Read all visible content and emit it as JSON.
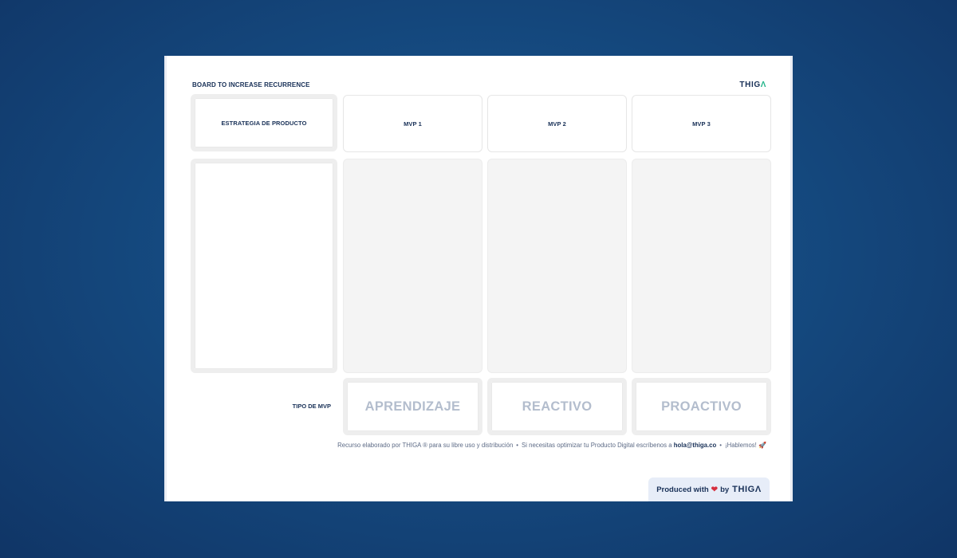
{
  "board": {
    "title": "BOARD TO INCREASE RECURRENCE",
    "logo": {
      "text": "THIG",
      "accent": "Λ"
    }
  },
  "columns": {
    "strategy_label": "ESTRATEGIA DE PRODUCTO",
    "mvp": [
      "MVP 1",
      "MVP 2",
      "MVP 3"
    ]
  },
  "tipo": {
    "label": "TIPO DE MVP",
    "values": [
      "APRENDIZAJE",
      "REACTIVO",
      "PROACTIVO"
    ]
  },
  "footer": {
    "part1": "Recurso elaborado por THIGA ® para su libre uso y distribución",
    "part2": "Si necesitas optimizar tu Producto Digital escríbenos a",
    "email": "hola@thiga.co",
    "part3": "¡Hablemos!",
    "separator": "•",
    "rocket": "🚀"
  },
  "produced": {
    "prefix": "Produced with",
    "heart": "❤",
    "by": "by",
    "brand": "THIGΛ"
  },
  "colors": {
    "background": "#154a80",
    "navy": "#183057",
    "accent_green": "#23b58a",
    "muted_text": "#b3bdcd"
  }
}
